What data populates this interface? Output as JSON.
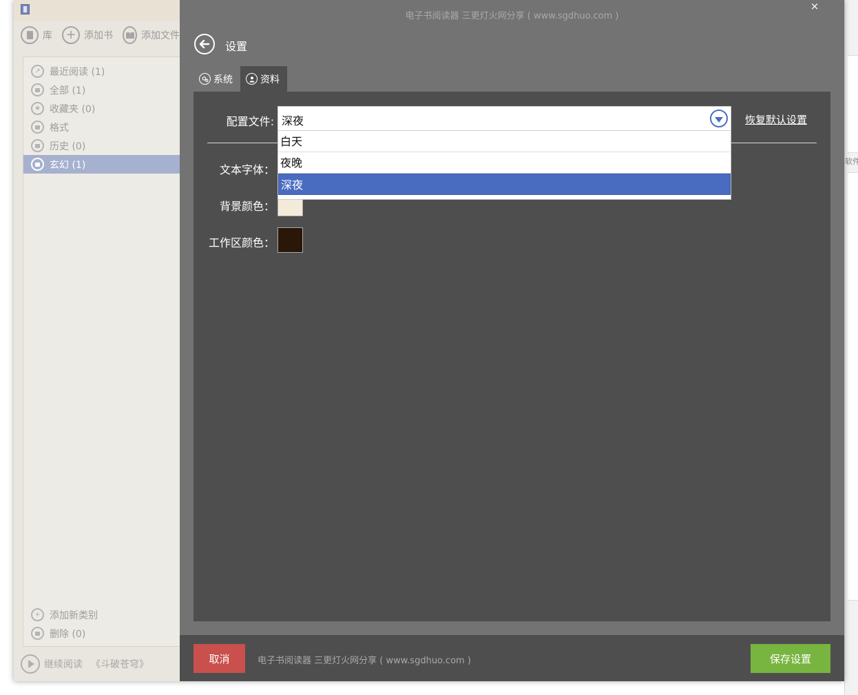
{
  "window": {
    "title": "电子书阅读器  三更灯火网分享 ( www.sgdhuo.com )",
    "close_glyph": "×"
  },
  "background_window": {
    "edge_text": "软件"
  },
  "toolbar": {
    "library_label": "库",
    "add_book_label": "添加书",
    "add_file_label": "添加文件"
  },
  "sidebar": {
    "items": [
      {
        "label": "最近阅读 (1)",
        "icon": "share-icon"
      },
      {
        "label": "全部 (1)",
        "icon": "book-icon"
      },
      {
        "label": "收藏夹 (0)",
        "icon": "star-icon"
      },
      {
        "label": "格式",
        "icon": "file-icon"
      },
      {
        "label": "历史 (0)",
        "icon": "folder-icon"
      },
      {
        "label": "玄幻 (1)",
        "icon": "folder-icon"
      }
    ],
    "add_category_label": "添加新类别",
    "delete_label": "删除 (0)",
    "continue_label": "继续阅读",
    "continue_book": "《斗破苍穹》"
  },
  "settings": {
    "title": "设置",
    "tabs": [
      {
        "label": "系统",
        "icon": "gears-icon"
      },
      {
        "label": "资料",
        "icon": "user-icon"
      }
    ],
    "profile_label": "配置文件:",
    "profile_value": "深夜",
    "profile_options": [
      "白天",
      "夜晚",
      "深夜"
    ],
    "restore_label": "恢复默认设置",
    "font_label": "文本字体：",
    "bg_color_label": "背景颜色：",
    "work_color_label": "工作区颜色：",
    "bg_color": "#f3ead9",
    "work_color": "#2a1708"
  },
  "footer": {
    "cancel_label": "取消",
    "text": "电子书阅读器  三更灯火网分享 ( www.sgdhuo.com )",
    "save_label": "保存设置"
  },
  "colors": {
    "accent": "#4a6cc0",
    "cancel": "#c9504d",
    "save": "#78b540",
    "sidebar_active": "#a6b0cf"
  }
}
